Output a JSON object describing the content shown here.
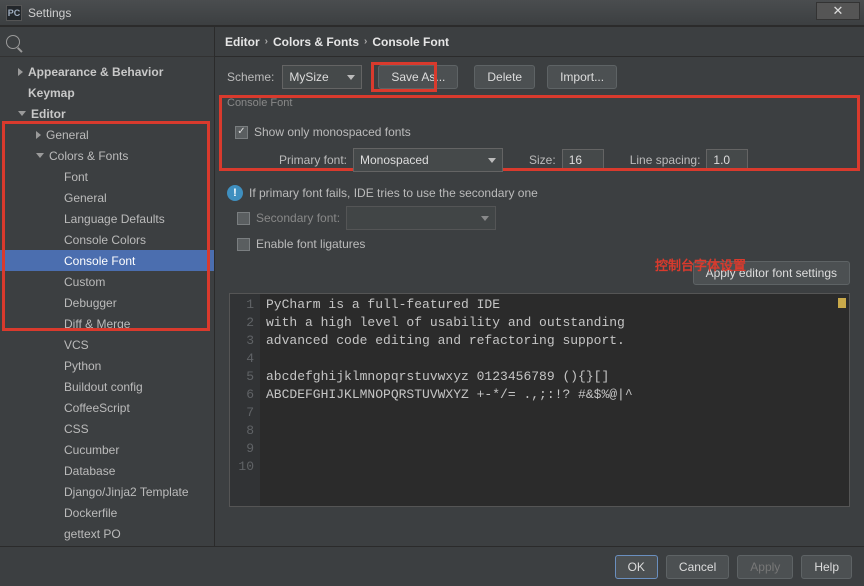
{
  "window": {
    "title": "Settings",
    "app_icon_text": "PC"
  },
  "breadcrumb": {
    "a": "Editor",
    "b": "Colors & Fonts",
    "c": "Console Font"
  },
  "sidebar": {
    "items": [
      {
        "label": "Appearance & Behavior",
        "depth": 0,
        "arrow": "right",
        "bold": true
      },
      {
        "label": "Keymap",
        "depth": 0,
        "arrow": "",
        "bold": true
      },
      {
        "label": "Editor",
        "depth": 0,
        "arrow": "down",
        "bold": true
      },
      {
        "label": "General",
        "depth": 1,
        "arrow": "right",
        "bold": false
      },
      {
        "label": "Colors & Fonts",
        "depth": 1,
        "arrow": "down",
        "bold": false
      },
      {
        "label": "Font",
        "depth": 2,
        "arrow": "",
        "bold": false
      },
      {
        "label": "General",
        "depth": 2,
        "arrow": "",
        "bold": false
      },
      {
        "label": "Language Defaults",
        "depth": 2,
        "arrow": "",
        "bold": false
      },
      {
        "label": "Console Colors",
        "depth": 2,
        "arrow": "",
        "bold": false
      },
      {
        "label": "Console Font",
        "depth": 2,
        "arrow": "",
        "bold": false,
        "selected": true
      },
      {
        "label": "Custom",
        "depth": 2,
        "arrow": "",
        "bold": false
      },
      {
        "label": "Debugger",
        "depth": 2,
        "arrow": "",
        "bold": false
      },
      {
        "label": "Diff & Merge",
        "depth": 2,
        "arrow": "",
        "bold": false
      },
      {
        "label": "VCS",
        "depth": 2,
        "arrow": "",
        "bold": false
      },
      {
        "label": "Python",
        "depth": 2,
        "arrow": "",
        "bold": false
      },
      {
        "label": "Buildout config",
        "depth": 2,
        "arrow": "",
        "bold": false
      },
      {
        "label": "CoffeeScript",
        "depth": 2,
        "arrow": "",
        "bold": false
      },
      {
        "label": "CSS",
        "depth": 2,
        "arrow": "",
        "bold": false
      },
      {
        "label": "Cucumber",
        "depth": 2,
        "arrow": "",
        "bold": false
      },
      {
        "label": "Database",
        "depth": 2,
        "arrow": "",
        "bold": false
      },
      {
        "label": "Django/Jinja2 Template",
        "depth": 2,
        "arrow": "",
        "bold": false
      },
      {
        "label": "Dockerfile",
        "depth": 2,
        "arrow": "",
        "bold": false
      },
      {
        "label": "gettext PO",
        "depth": 2,
        "arrow": "",
        "bold": false
      }
    ]
  },
  "scheme": {
    "label": "Scheme:",
    "value": "MySize",
    "save_as": "Save As...",
    "delete": "Delete",
    "import": "Import..."
  },
  "console": {
    "legend": "Console Font",
    "show_mono": "Show only monospaced fonts",
    "primary_label": "Primary font:",
    "primary_value": "Monospaced",
    "size_label": "Size:",
    "size_value": "16",
    "spacing_label": "Line spacing:",
    "spacing_value": "1.0",
    "info": "If primary font fails, IDE tries to use the secondary one",
    "secondary_label": "Secondary font:",
    "ligatures": "Enable font ligatures",
    "apply_editor": "Apply editor font settings"
  },
  "annotation": "控制台字体设置",
  "preview": {
    "lines": [
      "PyCharm is a full-featured IDE",
      "with a high level of usability and outstanding",
      "advanced code editing and refactoring support.",
      "",
      "abcdefghijklmnopqrstuvwxyz 0123456789 (){}[]",
      "ABCDEFGHIJKLMNOPQRSTUVWXYZ +-*/= .,;:!? #&$%@|^",
      "",
      "",
      "",
      ""
    ]
  },
  "footer": {
    "ok": "OK",
    "cancel": "Cancel",
    "apply": "Apply",
    "help": "Help"
  }
}
